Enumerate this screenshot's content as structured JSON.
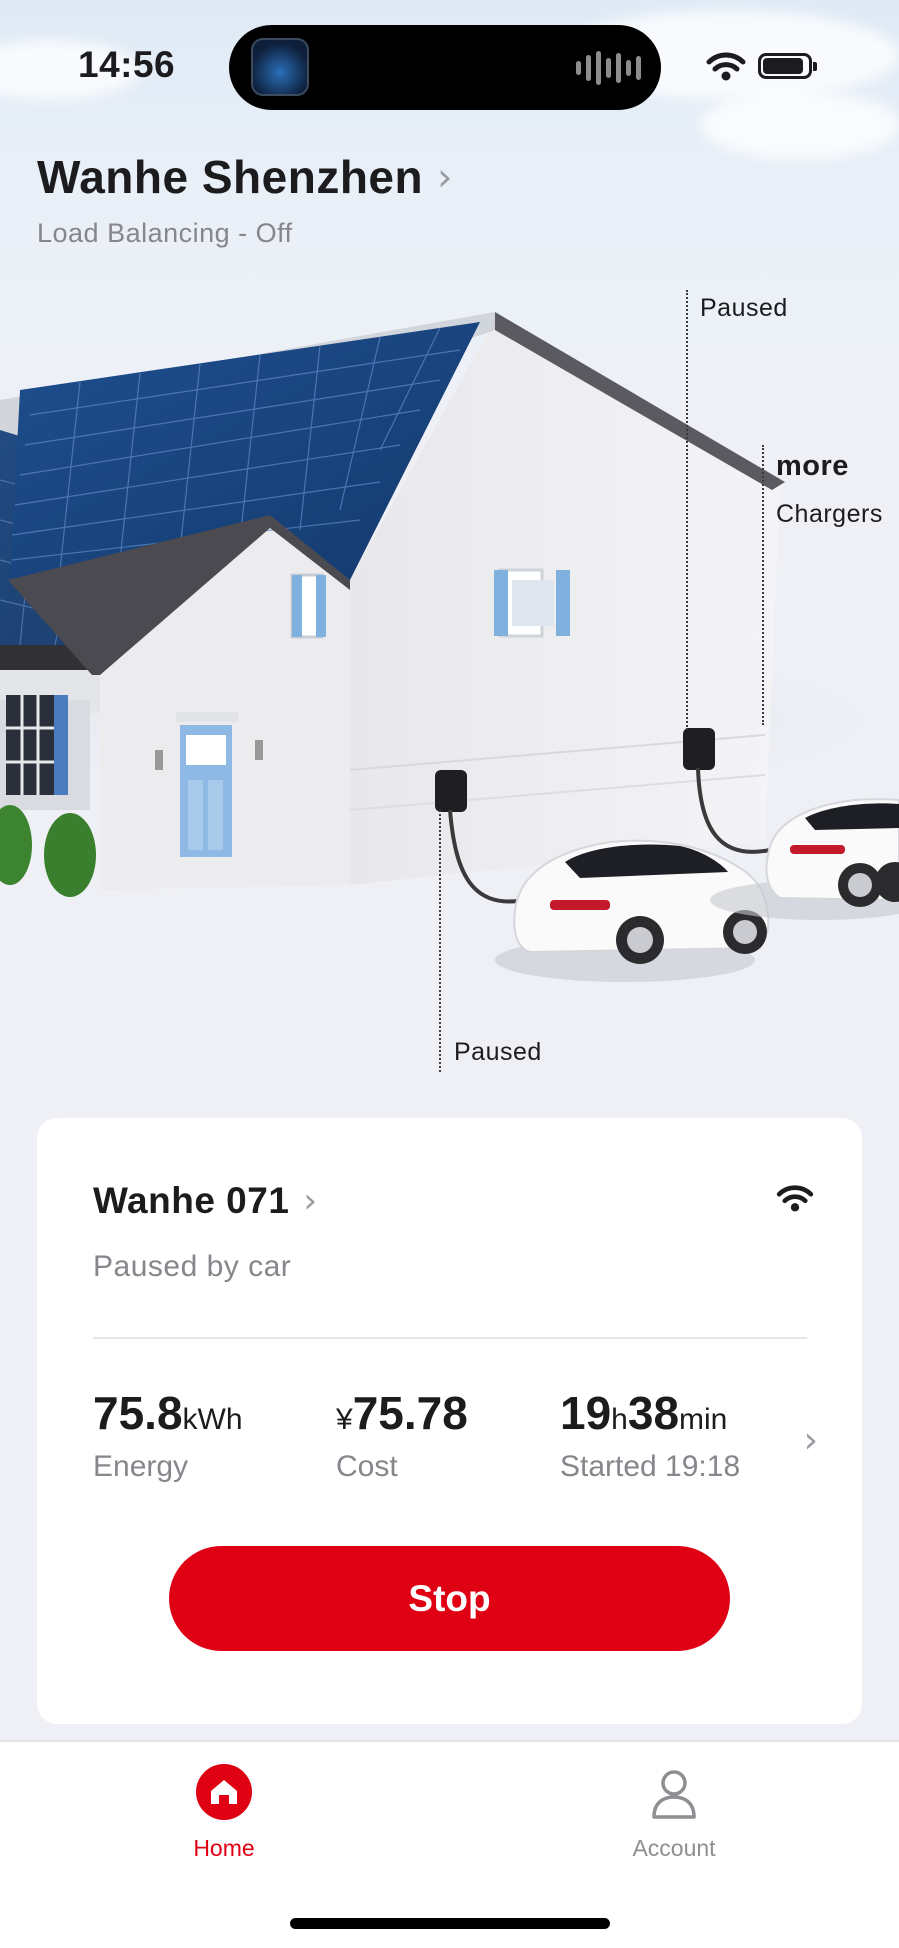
{
  "status_bar": {
    "time": "14:56"
  },
  "site": {
    "name": "Wanhe Shenzhen",
    "subtitle": "Load Balancing - Off"
  },
  "scene": {
    "callout_top": "Paused",
    "callout_more_title": "more",
    "callout_more_sub": "Chargers",
    "callout_bottom": "Paused"
  },
  "charger": {
    "name": "Wanhe 071",
    "status": "Paused by car",
    "energy": {
      "value": "75.8",
      "unit": "kWh",
      "label": "Energy"
    },
    "cost": {
      "symbol": "¥",
      "value": "75.78",
      "label": "Cost"
    },
    "duration": {
      "hours": "19",
      "h_unit": "h",
      "minutes": "38",
      "min_unit": "min",
      "label": "Started 19:18"
    },
    "stop_label": "Stop"
  },
  "tabbar": {
    "tabs": [
      {
        "label": "Home",
        "icon": "home-icon",
        "active": true
      },
      {
        "label": "Account",
        "icon": "person-icon",
        "active": false
      }
    ]
  },
  "colors": {
    "accent": "#e00014",
    "muted": "#86868c",
    "background": "#eef0f6"
  }
}
